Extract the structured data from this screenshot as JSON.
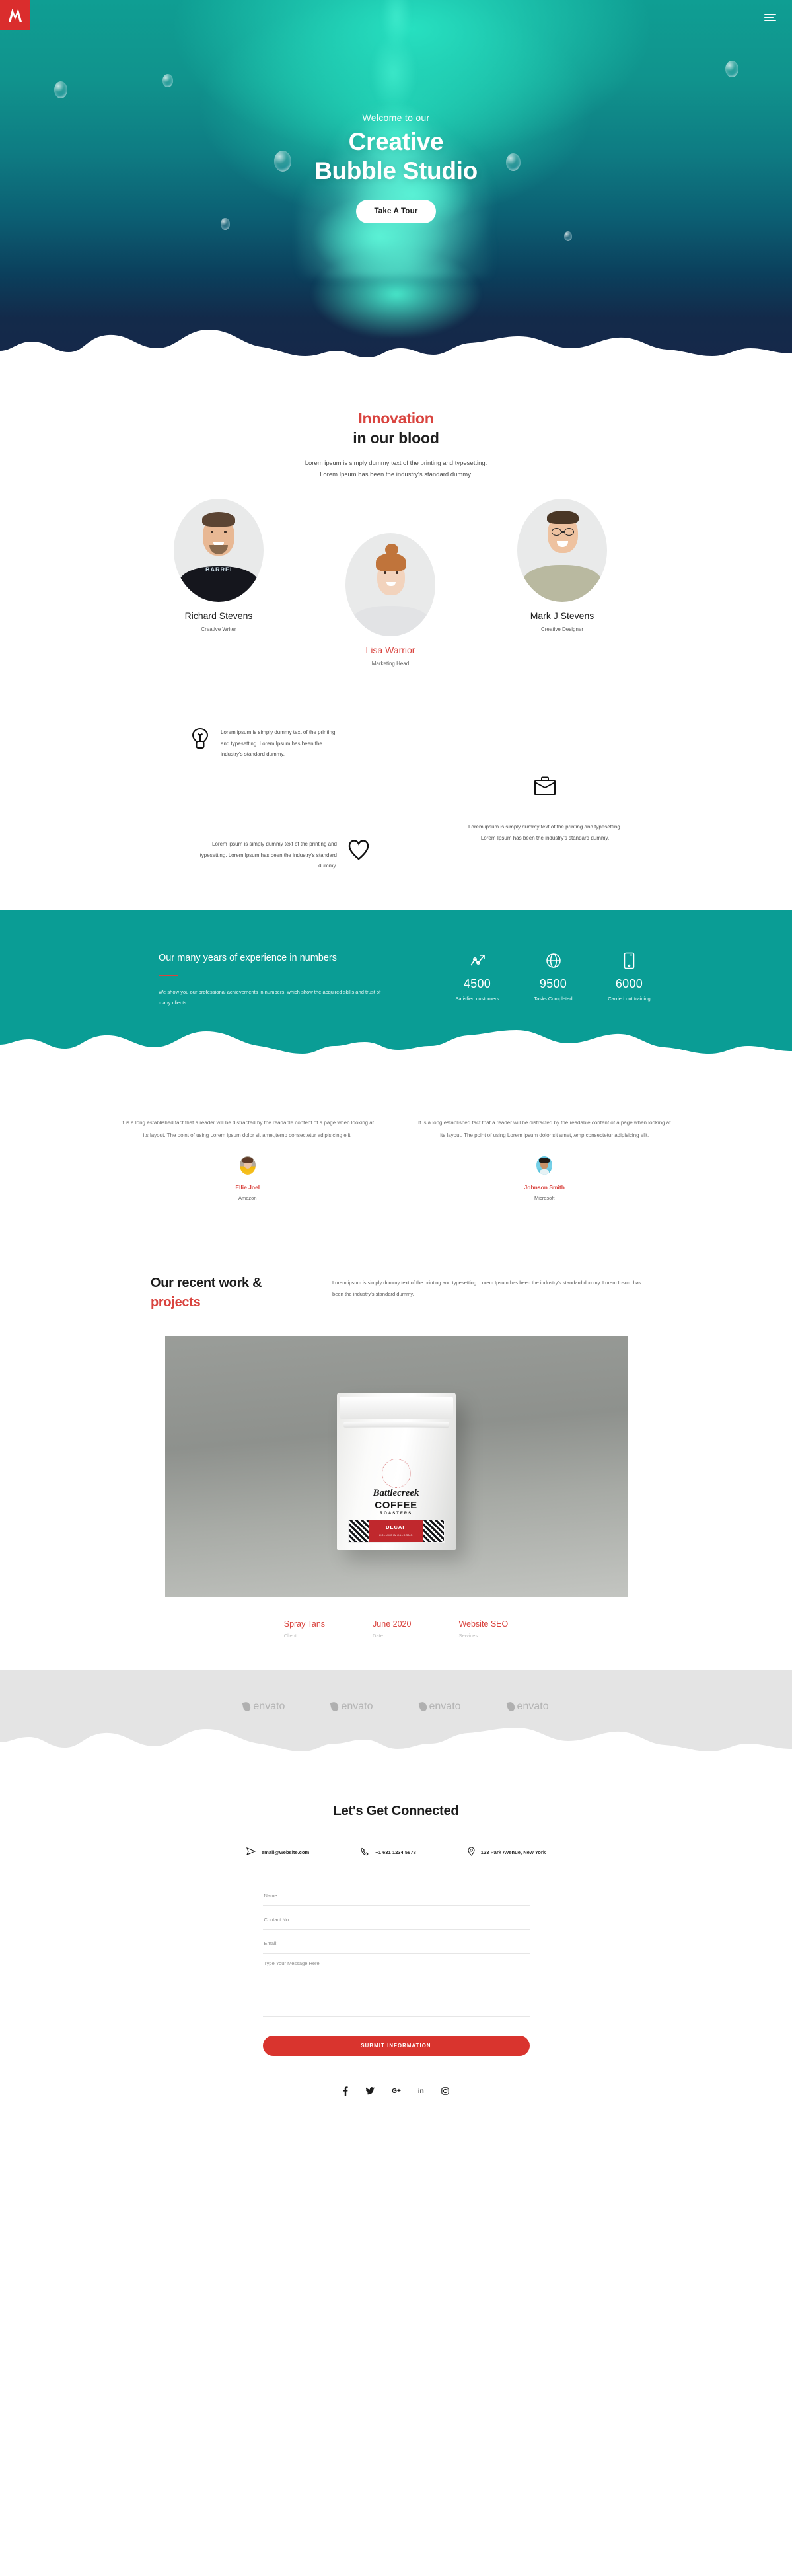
{
  "brand": {
    "logo_letter": "M",
    "logo_bg": "#da2d2d"
  },
  "nav": {
    "menu_icon": "hamburger-icon"
  },
  "hero": {
    "welcome": "Welcome to our",
    "title_line1": "Creative",
    "title_line2": "Bubble Studio",
    "cta": "Take A Tour"
  },
  "innovation": {
    "title_red": "Innovation",
    "title_dark": "in our blood",
    "sub_line1": "Lorem ipsum is simply dummy text of the printing and typesetting.",
    "sub_line2": "Lorem Ipsum has been the industry's standard dummy."
  },
  "team": [
    {
      "name": "Richard Stevens",
      "role": "Creative Writer"
    },
    {
      "name": "Lisa Warrior",
      "role": "Marketing Head"
    },
    {
      "name": "Mark J Stevens",
      "role": "Creative Designer"
    }
  ],
  "features": [
    {
      "icon": "lightbulb-icon",
      "text": "Lorem ipsum is simply dummy text of the printing and typesetting. Lorem Ipsum has been the industry's standard dummy."
    },
    {
      "icon": "briefcase-icon",
      "text": "Lorem ipsum is simply dummy text of the printing and typesetting. Lorem Ipsum has been the industry's standard dummy."
    },
    {
      "icon": "heart-icon",
      "text": "Lorem ipsum is simply dummy text of the printing and typesetting. Lorem Ipsum has been the industry's standard dummy."
    }
  ],
  "stats": {
    "heading": "Our many years of experience in numbers",
    "paragraph": "We show you our professional achievements in numbers, which show the acquired skills and trust of many clients.",
    "bg_color": "#0a9d95",
    "accent": "#d9443f",
    "items": [
      {
        "icon": "chart-arrow-icon",
        "number": "4500",
        "label": "Satisfied customers"
      },
      {
        "icon": "globe-icon",
        "number": "9500",
        "label": "Tasks Completed"
      },
      {
        "icon": "mobile-icon",
        "number": "6000",
        "label": "Carried out training"
      }
    ]
  },
  "testimonials": [
    {
      "quote": "It is a long established fact that a reader will be distracted by the readable content of a page when looking at its layout. The point of using Lorem ipsum dolor sit amet,temp consectetur adipisicing elit.",
      "name": "Ellie Joel",
      "company": "Amazon"
    },
    {
      "quote": "It is a long established fact that a reader will be distracted by the readable content of a page when looking at its layout. The point of using Lorem ipsum dolor sit amet,temp consectetur adipisicing elit.",
      "name": "Johnson Smith",
      "company": "Microsoft"
    }
  ],
  "projects": {
    "title_dark": "Our recent work &",
    "title_red": "projects",
    "description": "Lorem ipsum is simply dummy text of the printing and typesetting. Lorem Ipsum has been the industry's standard dummy. Lorem Ipsum has been the industry's standard dummy.",
    "image_alt": "Battlecreek Coffee Roasters Decaf bag",
    "product": {
      "brand": "Battlecreek",
      "name": "COFFEE",
      "sub": "ROASTERS",
      "variant": "DECAF",
      "origin": "COLUMBIA CALDONO"
    },
    "meta": [
      {
        "value": "Spray Tans",
        "label": "Client"
      },
      {
        "value": "June 2020",
        "label": "Date"
      },
      {
        "value": "Website SEO",
        "label": "Services"
      }
    ]
  },
  "clients": [
    {
      "name": "envato"
    },
    {
      "name": "envato"
    },
    {
      "name": "envato"
    },
    {
      "name": "envato"
    }
  ],
  "contact": {
    "heading": "Let's Get Connected",
    "info": [
      {
        "icon": "send-icon",
        "text": "email@website.com"
      },
      {
        "icon": "phone-icon",
        "text": "+1 631 1234 5678"
      },
      {
        "icon": "location-pin-icon",
        "text": "123 Park Avenue, New York"
      }
    ],
    "fields": {
      "name_placeholder": "Name:",
      "contact_placeholder": "Contact No:",
      "email_placeholder": "Email:",
      "message_placeholder": "Type Your Message Here"
    },
    "submit_label": "SUBMIT INFORMATION",
    "submit_color": "#d9342e"
  },
  "footer": {
    "social": [
      {
        "icon": "facebook-icon",
        "glyph": "f"
      },
      {
        "icon": "twitter-icon",
        "glyph": "✈"
      },
      {
        "icon": "google-plus-icon",
        "glyph": "G+"
      },
      {
        "icon": "linkedin-icon",
        "glyph": "in"
      },
      {
        "icon": "instagram-icon",
        "glyph": "□"
      }
    ]
  }
}
